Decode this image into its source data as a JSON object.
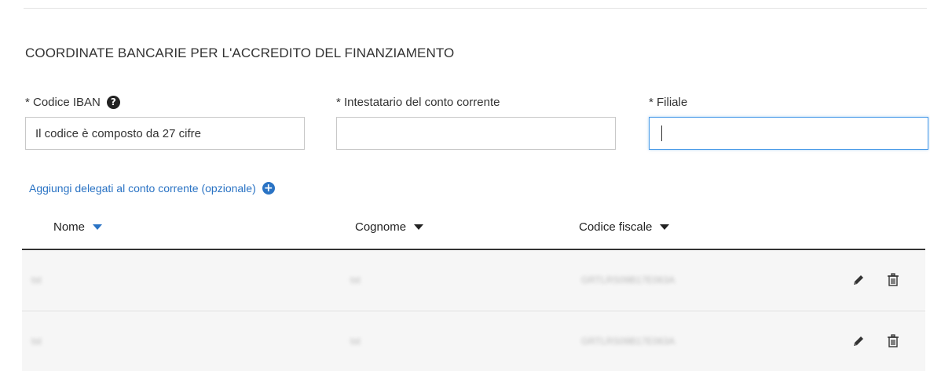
{
  "section": {
    "title": "COORDINATE BANCARIE PER L'ACCREDITO DEL FINANZIAMENTO"
  },
  "fields": {
    "iban": {
      "label": "* Codice IBAN",
      "placeholder": "Il codice è composto da 27 cifre",
      "value": ""
    },
    "holder": {
      "label": "* Intestatario del conto corrente",
      "placeholder": "",
      "value": ""
    },
    "branch": {
      "label": "* Filiale",
      "placeholder": "",
      "value": ""
    }
  },
  "delegates": {
    "add_label": "Aggiungi delegati al conto corrente (opzionale)",
    "columns": {
      "nome": "Nome",
      "cognome": "Cognome",
      "codice_fiscale": "Codice fiscale"
    },
    "rows": [
      {
        "nome": "tst",
        "cognome": "tst",
        "codice_fiscale": "GRTLRS09B17E063A"
      },
      {
        "nome": "tst",
        "cognome": "tst",
        "codice_fiscale": "GRTLRS09B17E063A"
      }
    ]
  },
  "icons": {
    "help": "question-circle-icon",
    "add": "plus-circle-icon",
    "sort": "caret-down-icon",
    "edit": "pencil-icon",
    "delete": "trash-icon"
  },
  "colors": {
    "link": "#2a73c4",
    "focus_border": "#4a9be8",
    "row_background": "#f6f6f6"
  }
}
